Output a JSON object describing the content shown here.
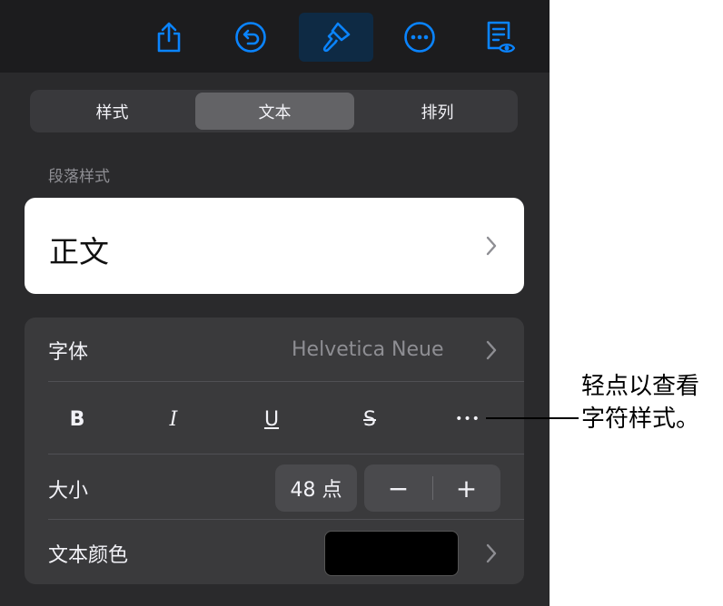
{
  "toolbar": {
    "icons": [
      "share-icon",
      "undo-icon",
      "paintbrush-icon",
      "more-icon",
      "reader-view-icon"
    ]
  },
  "segments": {
    "style": "样式",
    "text": "文本",
    "arrange": "排列",
    "selected": "文本"
  },
  "paragraph_style": {
    "section_label": "段落样式",
    "value": "正文"
  },
  "font": {
    "label": "字体",
    "value": "Helvetica Neue"
  },
  "format_buttons": {
    "bold": "B",
    "italic": "I",
    "underline": "U",
    "strikethrough": "S",
    "more": "•••"
  },
  "size": {
    "label": "大小",
    "value": "48 点",
    "decrement": "−",
    "increment": "+"
  },
  "text_color": {
    "label": "文本颜色",
    "swatch_color": "#000000"
  },
  "callout": {
    "line1": "轻点以查看",
    "line2": "字符样式。"
  },
  "colors": {
    "accent": "#0a84ff",
    "panel": "#2a2a2c",
    "group": "#3a3a3c"
  }
}
